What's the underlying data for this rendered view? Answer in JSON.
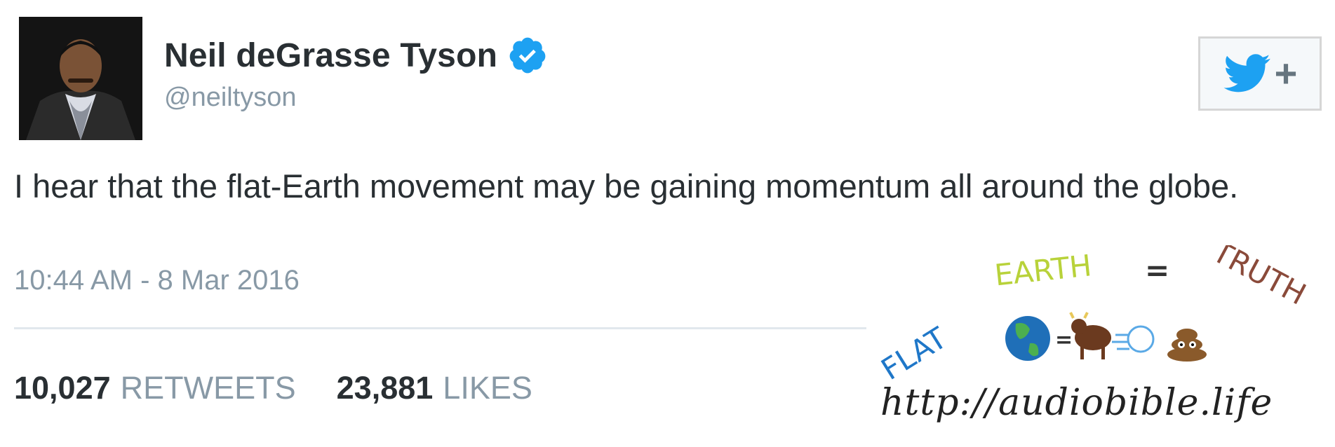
{
  "tweet": {
    "author_name": "Neil deGrasse Tyson",
    "handle": "@neiltyson",
    "text": "I hear that the flat-Earth movement may be gaining momentum all around the globe.",
    "timestamp": "10:44 AM - 8 Mar 2016",
    "retweets_count": "10,027",
    "retweets_label": "RETWEETS",
    "likes_count": "23,881",
    "likes_label": "LIKES"
  },
  "follow_button": {
    "icon": "twitter-bird-icon",
    "plus": "+"
  },
  "watermark": {
    "word_flat": "FLAT",
    "word_earth": "EARTH",
    "equals": "=",
    "word_truth": "TRUTH",
    "url": "http://audiobible.life"
  },
  "colors": {
    "text": "#292f33",
    "muted": "#8899a6",
    "verified": "#1da1f2",
    "twitter_blue": "#1da1f2",
    "flat": "#1f77c8",
    "earth": "#b8d23a",
    "truth": "#8a4a3a"
  }
}
